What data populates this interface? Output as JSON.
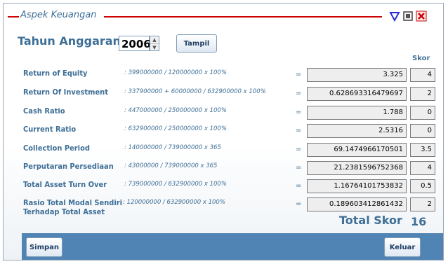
{
  "window": {
    "title": "Aspek Keuangan"
  },
  "filter": {
    "label": "Tahun Anggaran",
    "year": "2006",
    "button": "Tampil"
  },
  "table": {
    "skor_header": "Skor",
    "rows": [
      {
        "label": "Return of Equity",
        "formula": ": 399000000 / 120000000 x 100%",
        "eq": "=",
        "value": "3.325",
        "skor": "4"
      },
      {
        "label": "Return Of Investment",
        "formula": ": 337900000 + 60000000 / 632900000 x 100%",
        "eq": "=",
        "value": "0.628693316479697",
        "skor": "2"
      },
      {
        "label": "Cash Ratio",
        "formula": ": 447000000 / 250000000 x 100%",
        "eq": "=",
        "value": "1.788",
        "skor": "0"
      },
      {
        "label": "Current Ratio",
        "formula": ": 632900000 / 250000000 x 100%",
        "eq": "=",
        "value": "2.5316",
        "skor": "0"
      },
      {
        "label": "Collection Period",
        "formula": ": 140000000 / 739000000 x 365",
        "eq": "=",
        "value": "69.1474966170501",
        "skor": "3.5"
      },
      {
        "label": "Perputaran Persediaan",
        "formula": ": 43000000 / 739000000 x 365",
        "eq": "=",
        "value": "21.2381596752368",
        "skor": "4"
      },
      {
        "label": "Total Asset Turn Over",
        "formula": ": 739000000 / 632900000 x 100%",
        "eq": "=",
        "value": "1.16764101753832",
        "skor": "0.5"
      },
      {
        "label": "Rasio Total Modal Sendiri",
        "label2": "Terhadap Total Asset",
        "formula": ": 120000000 / 632900000 x 100%",
        "eq": "=",
        "value": "0.189603412861432",
        "skor": "2"
      }
    ]
  },
  "total": {
    "label": "Total Skor",
    "value": "16"
  },
  "footer": {
    "save": "Simpan",
    "exit": "Keluar"
  },
  "colors": {
    "accent": "#3e6f97",
    "title_line": "#cc0000",
    "footer_bar": "#5084b4"
  },
  "icons": [
    "minimize-triangle-icon",
    "maximize-icon",
    "close-x-icon"
  ]
}
